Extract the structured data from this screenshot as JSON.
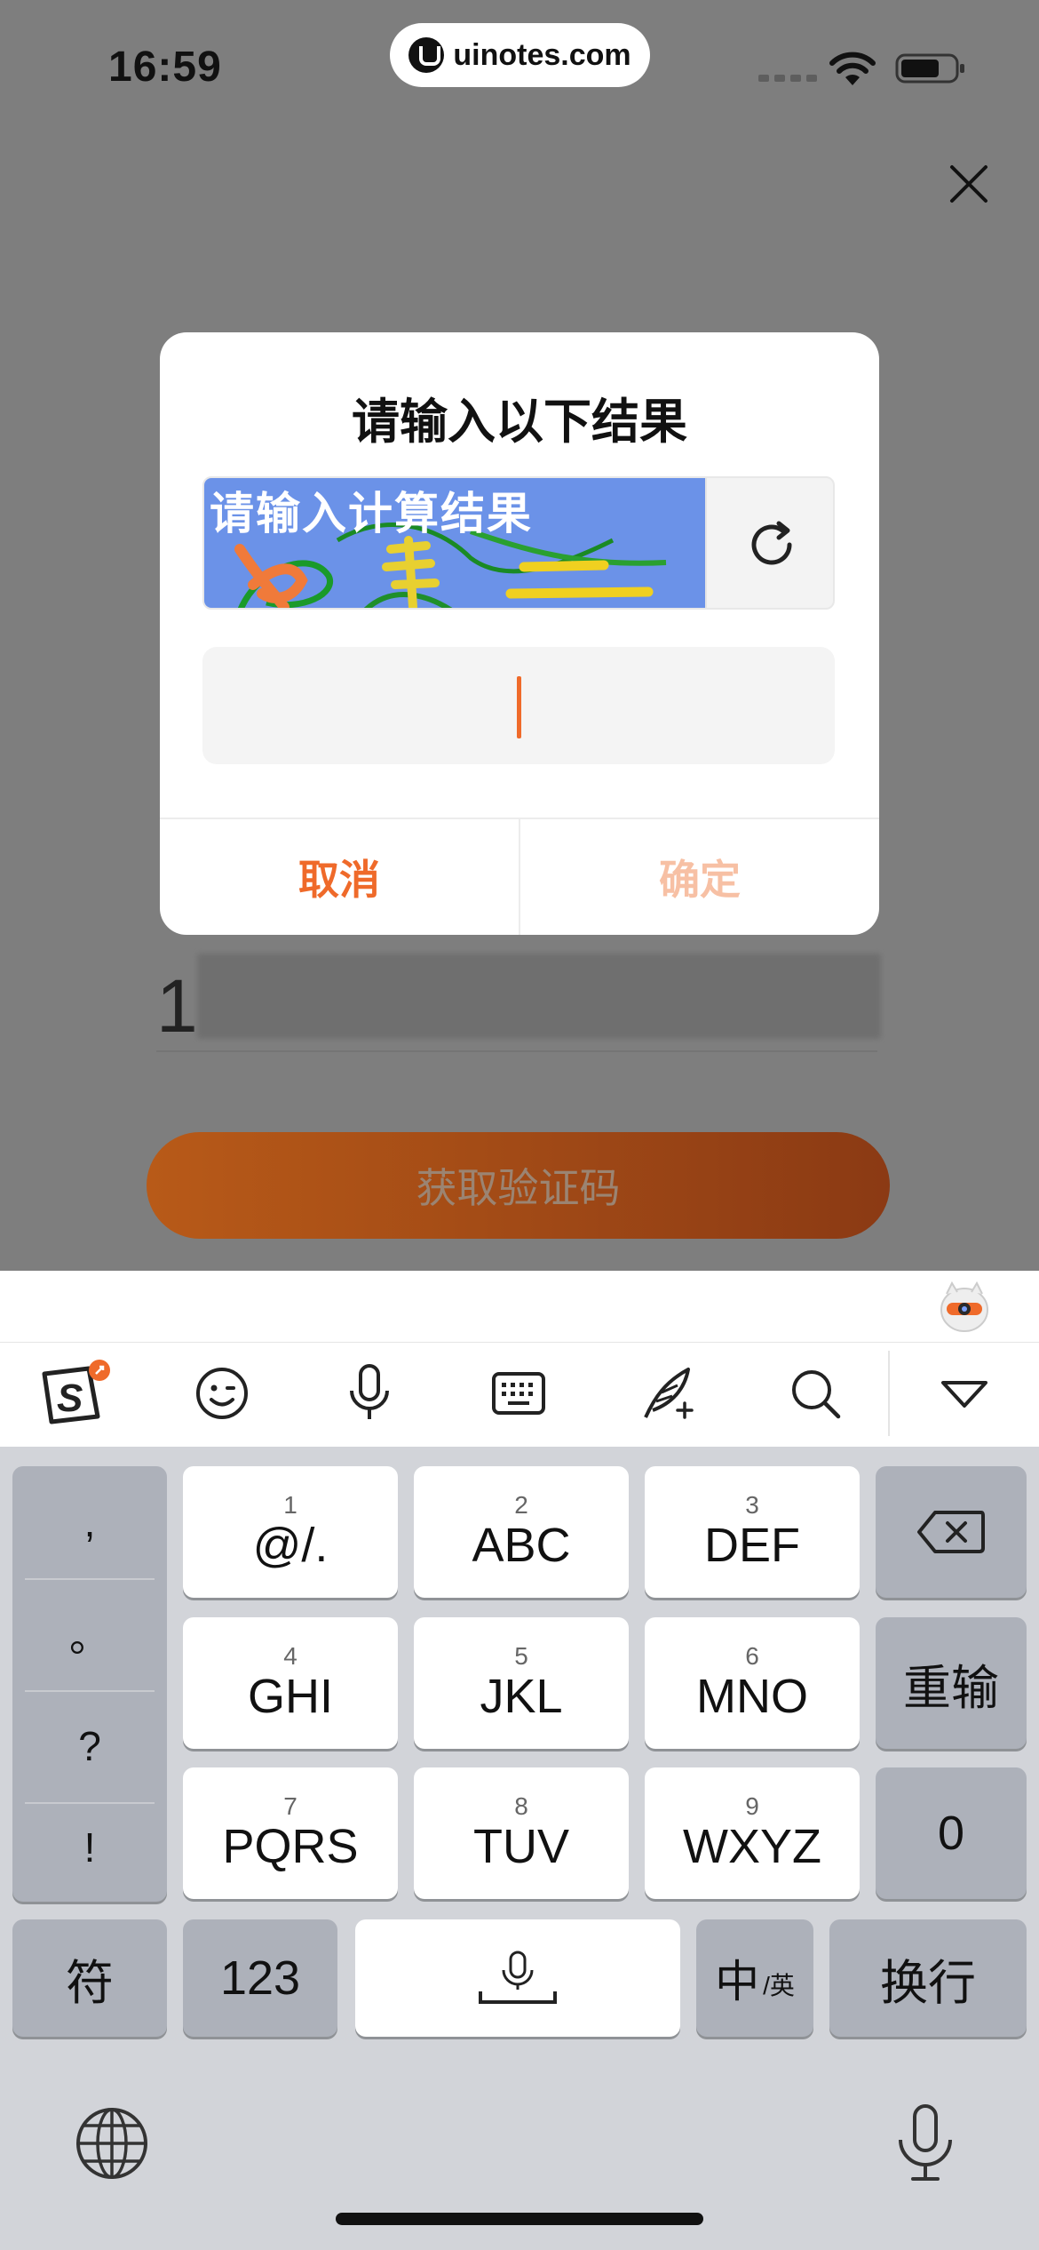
{
  "status_bar": {
    "time": "16:59",
    "url": "uinotes.com"
  },
  "dialog": {
    "title": "请输入以下结果",
    "captcha_text": "请输入计算结果",
    "cancel_label": "取消",
    "confirm_label": "确定"
  },
  "form": {
    "phone_prefix": "1",
    "get_code_label": "获取验证码"
  },
  "keyboard": {
    "punctuation": [
      ",",
      "。",
      "?",
      "!"
    ],
    "keys": [
      {
        "num": "1",
        "letters": "@/."
      },
      {
        "num": "2",
        "letters": "ABC"
      },
      {
        "num": "3",
        "letters": "DEF"
      },
      {
        "num": "4",
        "letters": "GHI"
      },
      {
        "num": "5",
        "letters": "JKL"
      },
      {
        "num": "6",
        "letters": "MNO"
      },
      {
        "num": "7",
        "letters": "PQRS"
      },
      {
        "num": "8",
        "letters": "TUV"
      },
      {
        "num": "9",
        "letters": "WXYZ"
      }
    ],
    "reenter_label": "重输",
    "zero_label": "0",
    "symbol_label": "符",
    "num_label": "123",
    "cn_label": "中",
    "en_label": "英",
    "newline_label": "换行"
  },
  "colors": {
    "accent": "#ef6a2a",
    "accent_disabled": "#f7c0a4",
    "captcha_bg": "#6b92e8"
  }
}
